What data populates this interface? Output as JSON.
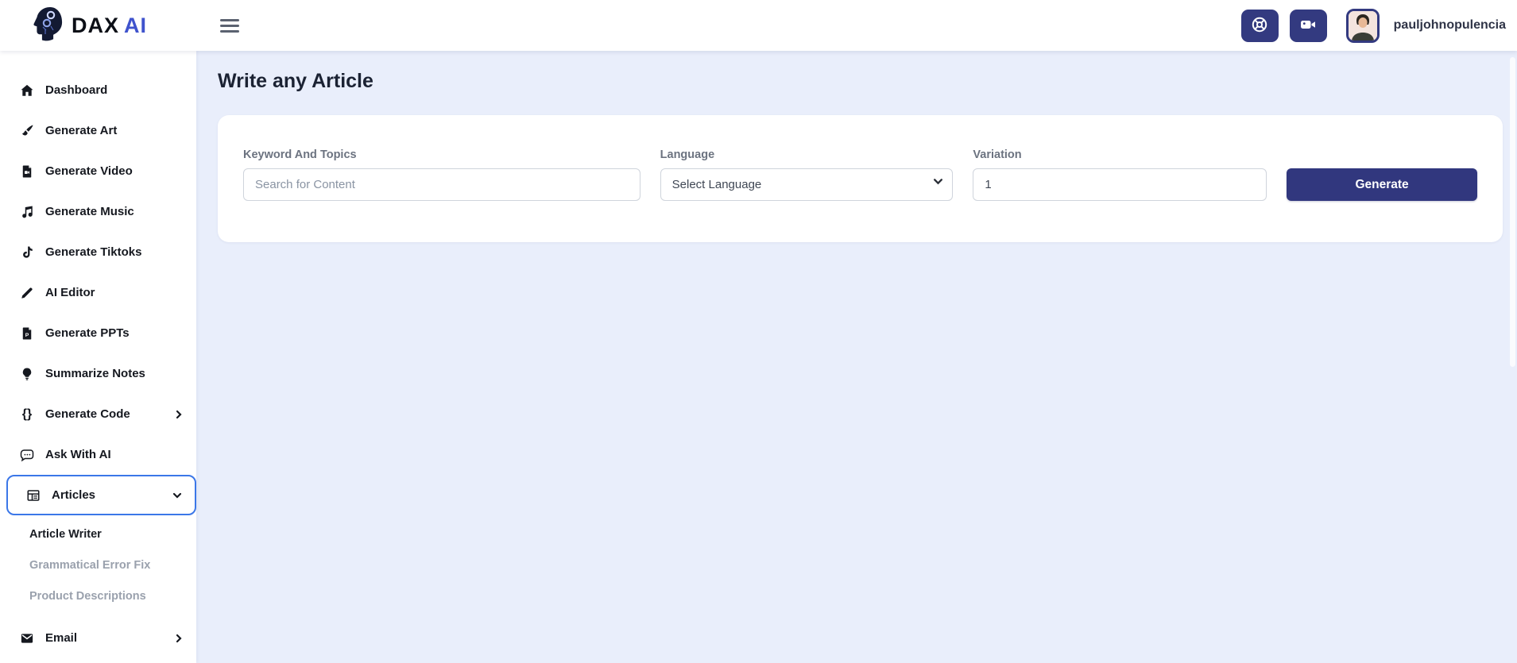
{
  "brand": {
    "text_primary": "DAX",
    "text_secondary": "AI",
    "logo_icon": "circuit-head"
  },
  "header": {
    "menu_icon": "hamburger-menu",
    "buttons": [
      {
        "icon": "life-ring"
      },
      {
        "icon": "video-camera"
      }
    ],
    "username": "pauljohnopulencia",
    "avatar_icon": "user-photo"
  },
  "sidebar": {
    "items": [
      {
        "label": "Dashboard",
        "icon": "home"
      },
      {
        "label": "Generate Art",
        "icon": "paintbrush"
      },
      {
        "label": "Generate Video",
        "icon": "file-video"
      },
      {
        "label": "Generate Music",
        "icon": "music-note"
      },
      {
        "label": "Generate Tiktoks",
        "icon": "tiktok"
      },
      {
        "label": "AI Editor",
        "icon": "pen"
      },
      {
        "label": "Generate PPTs",
        "icon": "file-ppt"
      },
      {
        "label": "Summarize Notes",
        "icon": "lightbulb"
      },
      {
        "label": "Generate Code",
        "icon": "code-braces",
        "chevron": "right"
      },
      {
        "label": "Ask With AI",
        "icon": "chat-bubble"
      },
      {
        "label": "Articles",
        "icon": "table-list",
        "chevron": "down",
        "active": true
      }
    ],
    "sub_items": [
      {
        "label": "Article Writer",
        "active": true
      },
      {
        "label": "Grammatical Error Fix",
        "active": false
      },
      {
        "label": "Product Descriptions",
        "active": false
      }
    ],
    "email_item": {
      "label": "Email",
      "icon": "envelope",
      "chevron": "right"
    }
  },
  "main": {
    "title": "Write any Article",
    "form": {
      "keyword": {
        "label": "Keyword And Topics",
        "placeholder": "Search for Content"
      },
      "language": {
        "label": "Language",
        "selected_option": "Select Language"
      },
      "variation": {
        "label": "Variation",
        "value": "1"
      },
      "submit_label": "Generate"
    }
  },
  "colors": {
    "accent_indigo": "#333a80",
    "active_border_blue": "#3b77e8",
    "main_background": "#e9eefb",
    "brand_blue": "#3f53cd"
  }
}
